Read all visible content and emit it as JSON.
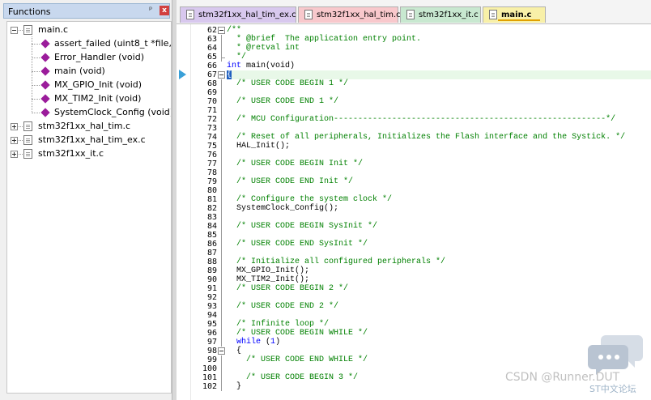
{
  "functions_panel": {
    "title": "Functions",
    "pin_glyph": "ᵖ",
    "close_glyph": "x",
    "tree": [
      {
        "label": "main.c",
        "expanded": true,
        "children": [
          "assert_failed (uint8_t *file, uir",
          "Error_Handler (void)",
          "main (void)",
          "MX_GPIO_Init (void)",
          "MX_TIM2_Init (void)",
          "SystemClock_Config (void)"
        ]
      },
      {
        "label": "stm32f1xx_hal_tim.c",
        "expanded": false,
        "children": []
      },
      {
        "label": "stm32f1xx_hal_tim_ex.c",
        "expanded": false,
        "children": []
      },
      {
        "label": "stm32f1xx_it.c",
        "expanded": false,
        "children": []
      }
    ]
  },
  "tabs": [
    {
      "label": "stm32f1xx_hal_tim_ex.c",
      "color": "#d8c8ee",
      "active": false
    },
    {
      "label": "stm32f1xx_hal_tim.c",
      "color": "#f8c8cc",
      "active": false
    },
    {
      "label": "stm32f1xx_it.c",
      "color": "#c8e8d0",
      "active": false
    },
    {
      "label": "main.c",
      "color": "#f8f0a8",
      "active": true
    }
  ],
  "editor": {
    "current_line": 67,
    "lines": [
      {
        "n": "62",
        "t": "/**",
        "c": true,
        "fold": "start"
      },
      {
        "n": "63",
        "t": "  * @brief  The application entry point.",
        "c": true
      },
      {
        "n": "64",
        "t": "  * @retval int",
        "c": true
      },
      {
        "n": "65",
        "t": "  */",
        "c": true,
        "fold": "end"
      },
      {
        "n": "66",
        "t": "int main(void)",
        "c": false,
        "kw": "int"
      },
      {
        "n": "67",
        "t": "{",
        "c": false,
        "fold": "start",
        "brace": true
      },
      {
        "n": "68",
        "t": "  /* USER CODE BEGIN 1 */",
        "c": true
      },
      {
        "n": "69",
        "t": "",
        "c": false
      },
      {
        "n": "70",
        "t": "  /* USER CODE END 1 */",
        "c": true
      },
      {
        "n": "71",
        "t": "",
        "c": false
      },
      {
        "n": "72",
        "t": "  /* MCU Configuration--------------------------------------------------------*/",
        "c": true
      },
      {
        "n": "73",
        "t": "",
        "c": false
      },
      {
        "n": "74",
        "t": "  /* Reset of all peripherals, Initializes the Flash interface and the Systick. */",
        "c": true
      },
      {
        "n": "75",
        "t": "  HAL_Init();",
        "c": false
      },
      {
        "n": "76",
        "t": "",
        "c": false
      },
      {
        "n": "77",
        "t": "  /* USER CODE BEGIN Init */",
        "c": true
      },
      {
        "n": "78",
        "t": "",
        "c": false
      },
      {
        "n": "79",
        "t": "  /* USER CODE END Init */",
        "c": true
      },
      {
        "n": "80",
        "t": "",
        "c": false
      },
      {
        "n": "81",
        "t": "  /* Configure the system clock */",
        "c": true
      },
      {
        "n": "82",
        "t": "  SystemClock_Config();",
        "c": false
      },
      {
        "n": "83",
        "t": "",
        "c": false
      },
      {
        "n": "84",
        "t": "  /* USER CODE BEGIN SysInit */",
        "c": true
      },
      {
        "n": "85",
        "t": "",
        "c": false
      },
      {
        "n": "86",
        "t": "  /* USER CODE END SysInit */",
        "c": true
      },
      {
        "n": "87",
        "t": "",
        "c": false
      },
      {
        "n": "88",
        "t": "  /* Initialize all configured peripherals */",
        "c": true
      },
      {
        "n": "89",
        "t": "  MX_GPIO_Init();",
        "c": false
      },
      {
        "n": "90",
        "t": "  MX_TIM2_Init();",
        "c": false
      },
      {
        "n": "91",
        "t": "  /* USER CODE BEGIN 2 */",
        "c": true
      },
      {
        "n": "92",
        "t": "",
        "c": false
      },
      {
        "n": "93",
        "t": "  /* USER CODE END 2 */",
        "c": true
      },
      {
        "n": "94",
        "t": "",
        "c": false
      },
      {
        "n": "95",
        "t": "  /* Infinite loop */",
        "c": true
      },
      {
        "n": "96",
        "t": "  /* USER CODE BEGIN WHILE */",
        "c": true
      },
      {
        "n": "97",
        "t": "  while (1)",
        "c": false,
        "kw": "while"
      },
      {
        "n": "98",
        "t": "  {",
        "c": false,
        "fold": "start"
      },
      {
        "n": "99",
        "t": "    /* USER CODE END WHILE */",
        "c": true
      },
      {
        "n": "100",
        "t": "",
        "c": false
      },
      {
        "n": "101",
        "t": "    /* USER CODE BEGIN 3 */",
        "c": true
      },
      {
        "n": "102",
        "t": "  }",
        "c": false
      }
    ]
  },
  "watermark": {
    "text": "CSDN @Runner.DUT",
    "forum_text": "ST中文论坛"
  }
}
